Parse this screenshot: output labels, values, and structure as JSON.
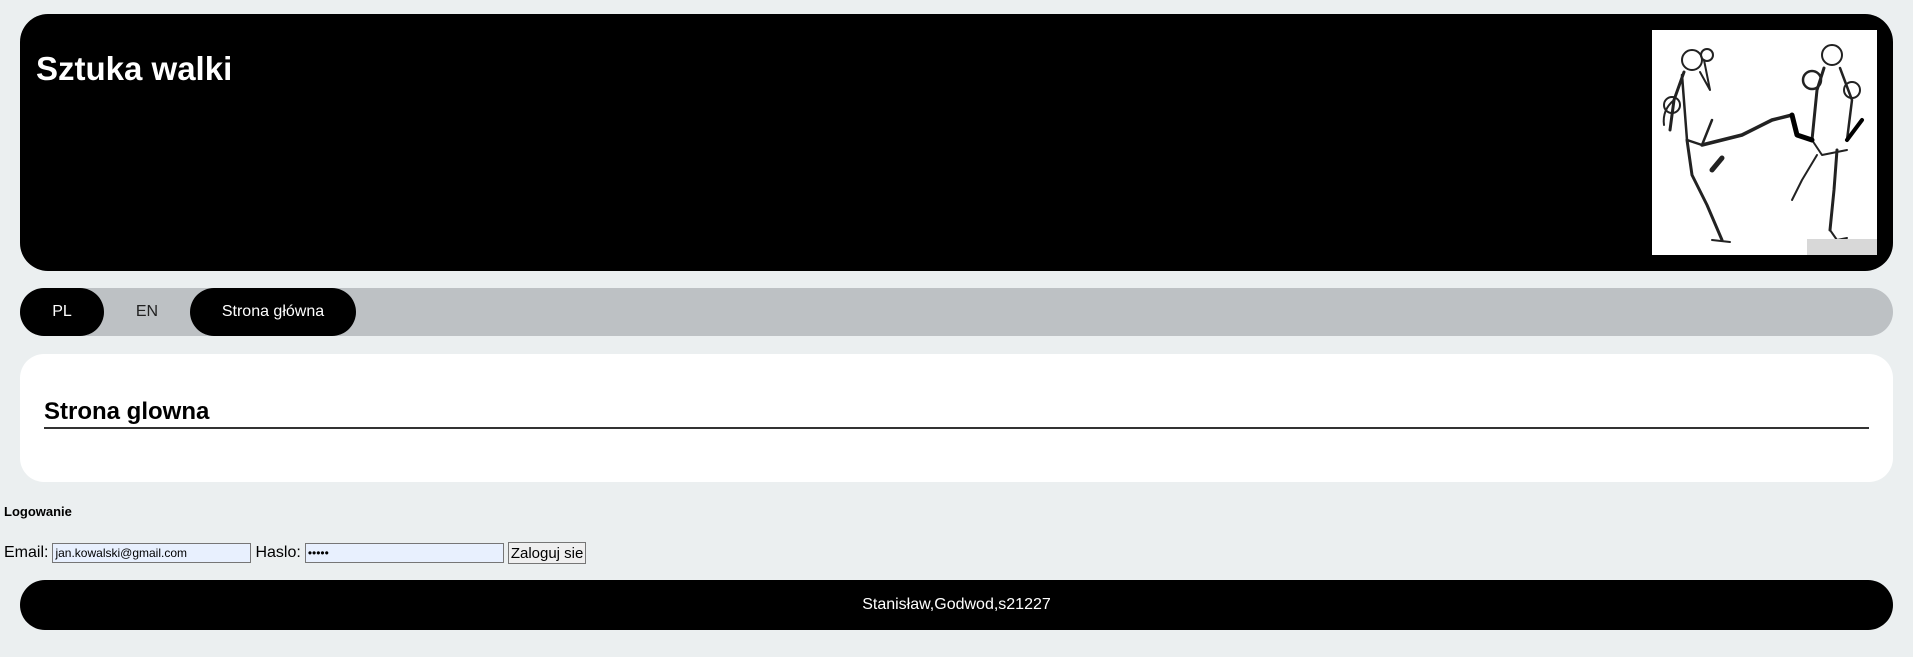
{
  "header": {
    "title": "Sztuka walki",
    "image_icon": "kickboxers-sketch-image"
  },
  "nav": {
    "items": [
      {
        "label": "PL",
        "active": true
      },
      {
        "label": "EN",
        "active": false
      },
      {
        "label": "Strona główna",
        "active": true
      }
    ]
  },
  "content": {
    "heading": "Strona glowna"
  },
  "login": {
    "title": "Logowanie",
    "email_label": "Email:",
    "email_value": "jan.kowalski@gmail.com",
    "password_label": "Haslo:",
    "password_value": "•••••",
    "submit_label": "Zaloguj sie"
  },
  "footer": {
    "text": "Stanisław,Godwod,s21227"
  },
  "colors": {
    "background": "#ebeff0",
    "header_bg": "#000000",
    "nav_bg": "#bdc1c4",
    "content_bg": "#ffffff",
    "input_bg": "#e8f0fe"
  }
}
